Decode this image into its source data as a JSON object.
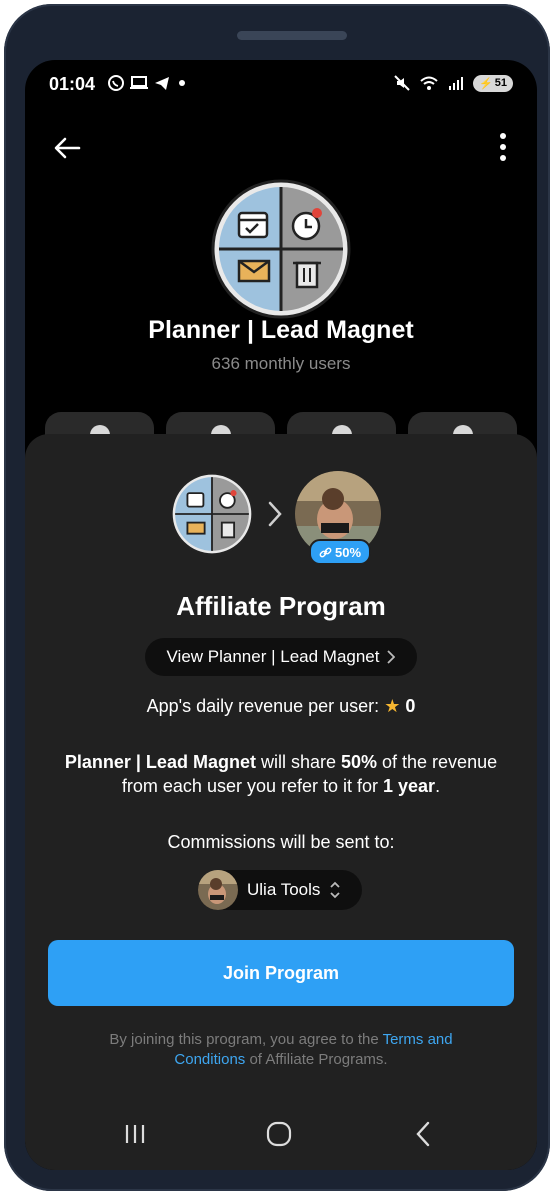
{
  "status_bar": {
    "time": "01:04",
    "battery": "51",
    "icons": [
      "whatsapp-icon",
      "laptop-icon",
      "telegram-icon",
      "dot-icon",
      "mute-icon",
      "wifi-icon",
      "signal-icon",
      "battery-icon"
    ]
  },
  "header": {
    "back_icon": "arrow-left-icon",
    "more_icon": "more-vertical-icon"
  },
  "app": {
    "title": "Planner | Lead Magnet",
    "subtitle": "636 monthly users"
  },
  "affiliate": {
    "badge": "50%",
    "title": "Affiliate Program",
    "view_button": "View Planner | Lead Magnet",
    "revenue_label": "App's daily revenue per user:",
    "revenue_value": "0",
    "share_part1": "Planner | Lead Magnet",
    "share_part2": " will share ",
    "share_part3": "50%",
    "share_part4": " of the revenue from each user you refer to it for ",
    "share_part5": "1 year",
    "share_part6": ".",
    "commissions_label": "Commissions will be sent to:",
    "recipient_name": "Ulia Tools",
    "join_button": "Join Program",
    "terms_prefix": "By joining this program, you agree to the ",
    "terms_link": "Terms and Conditions",
    "terms_suffix": " of Affiliate Programs."
  },
  "colors": {
    "accent": "#2ea0f5",
    "sheet_bg": "#212121",
    "link": "#3ea6f0"
  }
}
